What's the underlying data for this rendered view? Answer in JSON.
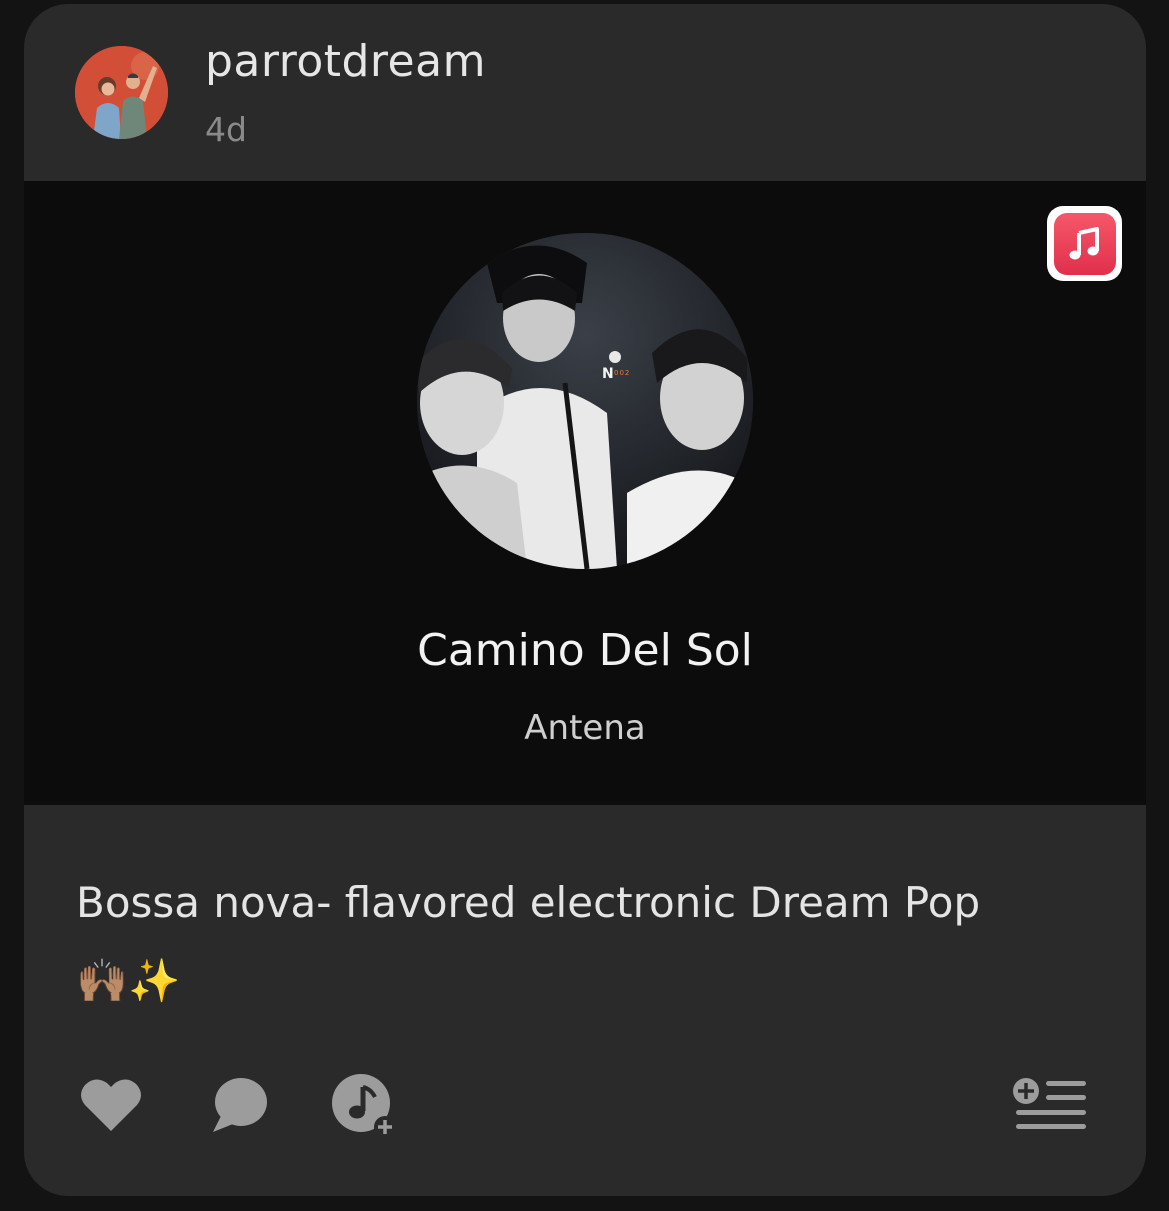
{
  "post": {
    "username": "parrotdream",
    "time_ago": "4d",
    "caption": "Bossa nova- flavored electronic Dream Pop",
    "caption_emoji": "🙌🏽✨"
  },
  "song": {
    "title": "Camino Del Sol",
    "artist": "Antena",
    "album_art_label": "N 002",
    "service_icon": "apple-music-icon"
  },
  "actions": {
    "like_icon": "heart-icon",
    "comment_icon": "speech-bubble-icon",
    "add_song_icon": "music-note-add-icon",
    "queue_icon": "add-to-queue-icon"
  },
  "colors": {
    "card_bg": "#2a2a2a",
    "song_panel_bg": "#0c0c0c",
    "icon_gray": "#9a9a9a",
    "apple_music_red": "#f0475e"
  }
}
